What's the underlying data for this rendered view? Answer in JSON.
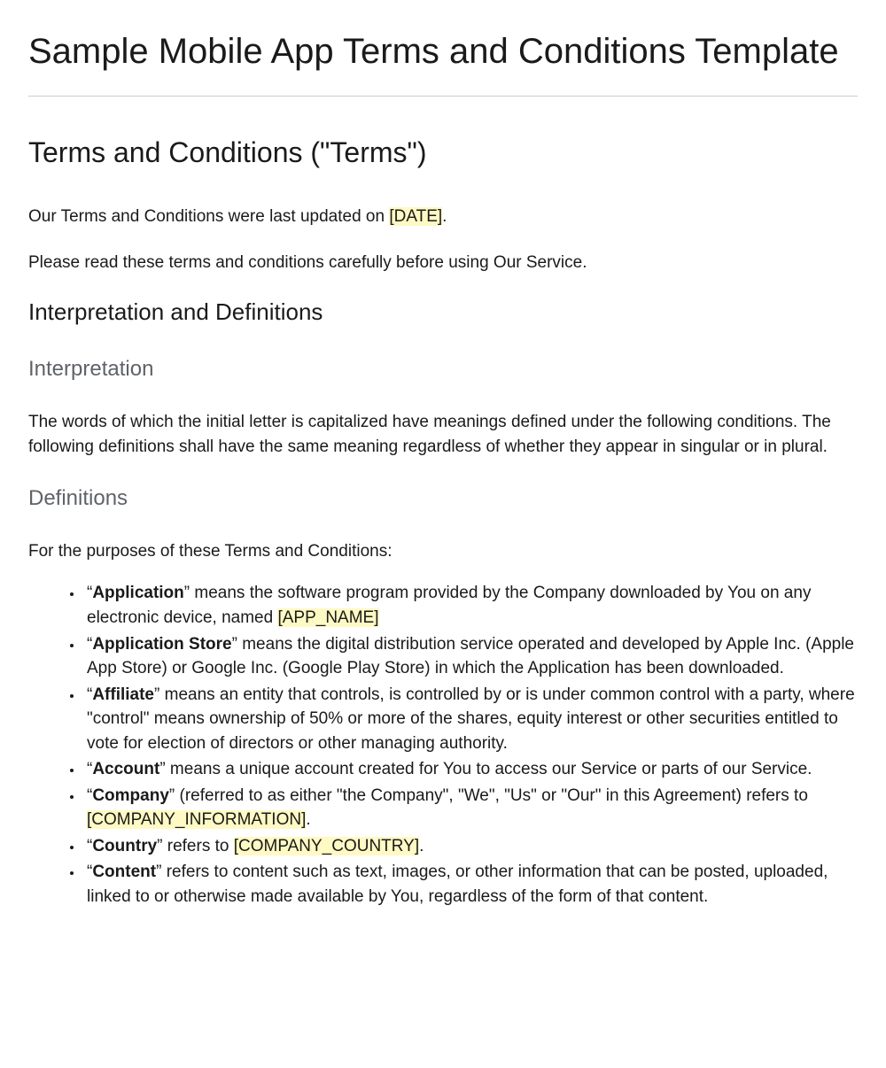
{
  "title": "Sample Mobile App Terms and Conditions Template",
  "section_title": "Terms and Conditions (\"Terms\")",
  "intro_text_prefix": "Our Terms and Conditions were last updated on ",
  "intro_text_placeholder": "[DATE]",
  "intro_text_suffix": ".",
  "intro_text_2": "Please read these terms and conditions carefully before using Our Service.",
  "interp_heading": "Interpretation and Definitions",
  "interp_sub": "Interpretation",
  "interp_body": "The words of which the initial letter is capitalized have meanings defined under the following conditions. The following definitions shall have the same meaning regardless of whether they appear in singular or in plural.",
  "defs_sub": "Definitions",
  "defs_intro": "For the purposes of these Terms and Conditions:",
  "defs": {
    "application": {
      "term": "Application",
      "pre": "“",
      "post": "” means the software program provided by the Company downloaded by You on any electronic device, named ",
      "placeholder": "[APP_NAME]"
    },
    "application_store": {
      "term": "Application Store",
      "pre": "“",
      "post": "” means the digital distribution service operated and developed by Apple Inc. (Apple App Store) or Google Inc. (Google Play Store) in which the Application has been downloaded."
    },
    "affiliate": {
      "term": "Affiliate",
      "pre": "“",
      "post": "” means an entity that controls, is controlled by or is under common control with a party, where \"control\" means ownership of 50% or more of the shares, equity interest or other securities entitled to vote for election of directors or other managing authority."
    },
    "account": {
      "term": "Account",
      "pre": "“",
      "post": "” means a unique account created for You to access our Service or parts of our Service."
    },
    "company": {
      "term": "Company",
      "pre": "“",
      "post": "” (referred to as either \"the Company\", \"We\", \"Us\" or \"Our\" in this Agreement) refers to ",
      "placeholder": "[COMPANY_INFORMATION]",
      "trail": "."
    },
    "country": {
      "term": "Country",
      "pre": "“",
      "post": "” refers to ",
      "placeholder": "[COMPANY_COUNTRY]",
      "trail": "."
    },
    "content": {
      "term": "Content",
      "pre": "“",
      "post": "” refers to content such as text, images, or other information that can be posted, uploaded, linked to or otherwise made available by You, regardless of the form of that content."
    }
  }
}
